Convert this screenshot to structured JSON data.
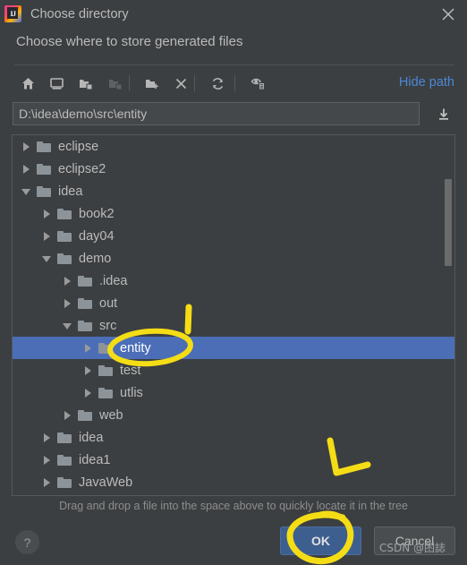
{
  "window": {
    "title": "Choose directory",
    "app_icon": "intellij-idea-logo",
    "close_icon": "close-icon"
  },
  "subtitle": "Choose where to store generated files",
  "toolbar": {
    "buttons": [
      {
        "name": "home-icon",
        "title": "Home",
        "enabled": true
      },
      {
        "name": "desktop-icon",
        "title": "Desktop",
        "enabled": true
      },
      {
        "name": "expand-folder-icon",
        "title": "Project Directory",
        "enabled": true
      },
      {
        "name": "collapse-folder-icon",
        "title": "Module Directory",
        "enabled": false
      },
      {
        "name": "new-folder-icon",
        "title": "New Folder",
        "enabled": true
      },
      {
        "name": "delete-icon",
        "title": "Delete",
        "enabled": true
      },
      {
        "name": "refresh-icon",
        "title": "Refresh",
        "enabled": true
      },
      {
        "name": "show-hidden-files-icon",
        "title": "Show Hidden Files",
        "enabled": true
      }
    ],
    "hide_path_label": "Hide path"
  },
  "path": {
    "value": "D:\\idea\\demo\\src\\entity",
    "placeholder": "",
    "download_icon": "insert-path-icon"
  },
  "tree": {
    "rows": [
      {
        "label": "eclipse",
        "depth": 0,
        "state": "collapsed",
        "selected": false
      },
      {
        "label": "eclipse2",
        "depth": 0,
        "state": "collapsed",
        "selected": false
      },
      {
        "label": "idea",
        "depth": 0,
        "state": "expanded",
        "selected": false
      },
      {
        "label": "book2",
        "depth": 1,
        "state": "collapsed",
        "selected": false
      },
      {
        "label": "day04",
        "depth": 1,
        "state": "collapsed",
        "selected": false
      },
      {
        "label": "demo",
        "depth": 1,
        "state": "expanded",
        "selected": false
      },
      {
        "label": ".idea",
        "depth": 2,
        "state": "collapsed",
        "selected": false
      },
      {
        "label": "out",
        "depth": 2,
        "state": "collapsed",
        "selected": false
      },
      {
        "label": "src",
        "depth": 2,
        "state": "expanded",
        "selected": false
      },
      {
        "label": "entity",
        "depth": 3,
        "state": "collapsed",
        "selected": true
      },
      {
        "label": "test",
        "depth": 3,
        "state": "collapsed",
        "selected": false
      },
      {
        "label": "utlis",
        "depth": 3,
        "state": "collapsed",
        "selected": false
      },
      {
        "label": "web",
        "depth": 2,
        "state": "collapsed",
        "selected": false
      },
      {
        "label": "idea",
        "depth": 1,
        "state": "collapsed",
        "selected": false
      },
      {
        "label": "idea1",
        "depth": 1,
        "state": "collapsed",
        "selected": false
      },
      {
        "label": "JavaWeb",
        "depth": 1,
        "state": "collapsed",
        "selected": false
      }
    ]
  },
  "hint": "Drag and drop a file into the space above to quickly locate it in the tree",
  "footer": {
    "help_label": "?",
    "ok_label": "OK",
    "cancel_label": "Cancel"
  },
  "watermark": "CSDN @囨誌",
  "colors": {
    "background": "#3c3f41",
    "selection": "#4b6eb7",
    "link": "#4a88d8",
    "ok_button": "#3c5f8f",
    "annotation": "#f5dd16",
    "text": "#bbbbbb"
  }
}
